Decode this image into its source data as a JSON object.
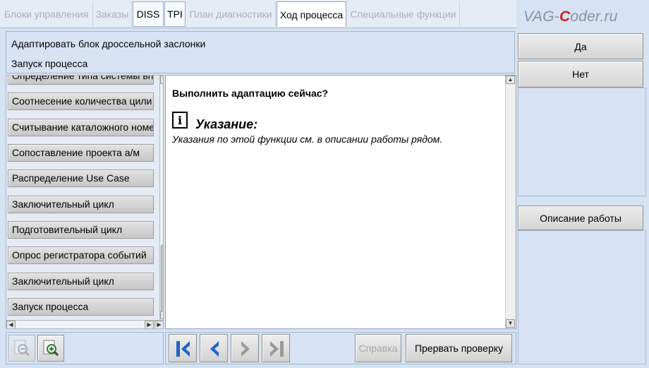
{
  "tabs": [
    {
      "label": "Блоки управления",
      "state": "disabled"
    },
    {
      "label": "Заказы",
      "state": "disabled"
    },
    {
      "label": "DISS",
      "state": "enabled"
    },
    {
      "label": "TPI",
      "state": "enabled"
    },
    {
      "label": "План диагностики",
      "state": "disabled"
    },
    {
      "label": "Ход процесса",
      "state": "active"
    },
    {
      "label": "Специальные функции",
      "state": "disabled"
    }
  ],
  "brand": {
    "prefix": "VAG-",
    "accent": "C",
    "suffix": "oder.ru"
  },
  "header": {
    "line1": "Адаптировать блок дроссельной заслонки",
    "line2": "Запуск процесса"
  },
  "right_buttons": {
    "yes": "Да",
    "no": "Нет",
    "description": "Описание работы"
  },
  "left_list": {
    "items": [
      "Определение типа системы вп",
      "Соотнесение количества цили",
      "Считывание каталожного номе",
      "Сопоставление проекта а/м",
      "Распределение Use Case",
      "Заключительный цикл",
      "Подготовительный цикл",
      "Опрос регистратора событий",
      "Заключительный цикл",
      "Запуск процесса"
    ]
  },
  "main": {
    "question": "Выполнить адаптацию сейчас?",
    "hint_icon": "i",
    "hint_title": "Указание:",
    "hint_text": "Указания по этой функции см. в описании работы рядом."
  },
  "bottom": {
    "help": "Справка",
    "abort": "Прервать проверку"
  },
  "icons": {
    "zoom_out": "zoom-out-icon",
    "zoom_in": "zoom-in-icon",
    "first": "first-page-icon",
    "prev": "previous-icon",
    "next": "next-icon",
    "last": "last-page-icon"
  },
  "colors": {
    "accent_blue": "#1f64c8",
    "brand_red": "#cc1f1f",
    "panel_bg": "#d7e3f2"
  }
}
